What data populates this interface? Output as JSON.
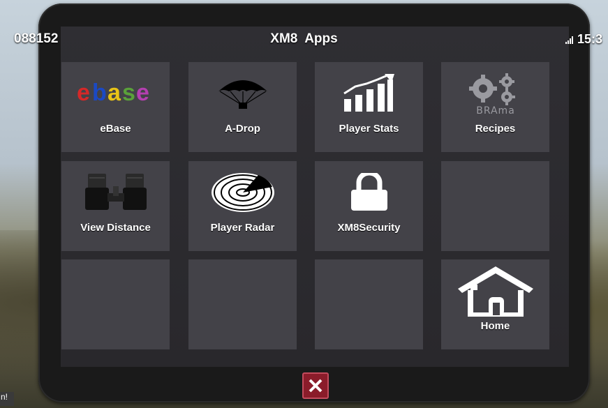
{
  "status": {
    "left_text": "088152",
    "time": "15:3"
  },
  "title": "XM8  Apps",
  "apps": [
    {
      "label": "eBase",
      "icon": "ebase-logo-icon"
    },
    {
      "label": "A-Drop",
      "icon": "parachute-icon"
    },
    {
      "label": "Player Stats",
      "icon": "bar-chart-up-icon"
    },
    {
      "label": "Recipes",
      "icon": "gears-brama-icon",
      "icon_text": "BRAma"
    },
    {
      "label": "View Distance",
      "icon": "binoculars-icon"
    },
    {
      "label": "Player Radar",
      "icon": "radar-icon"
    },
    {
      "label": "XM8Security",
      "icon": "padlock-icon"
    },
    {
      "label": "",
      "icon": ""
    },
    {
      "label": "",
      "icon": ""
    },
    {
      "label": "",
      "icon": ""
    },
    {
      "label": "",
      "icon": ""
    },
    {
      "label": "Home",
      "icon": "home-icon"
    }
  ],
  "close_icon": "close-icon",
  "corner_text": "n!",
  "colors": {
    "tile_bg": "#434248",
    "screen_bg": "#2f2e33",
    "close_bg": "#8a1c2a"
  }
}
